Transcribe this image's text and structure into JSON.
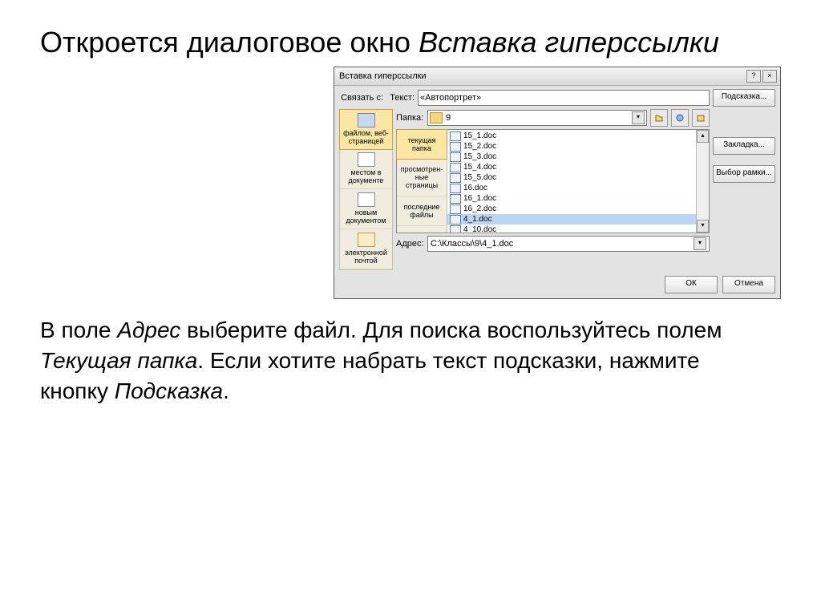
{
  "heading": {
    "prefix": "Откроется диалоговое окно ",
    "italic": "Вставка гиперссылки"
  },
  "dialog": {
    "title": "Вставка гиперссылки",
    "help_btn": "?",
    "close_btn": "×",
    "link_to_label": "Связать с:",
    "text_label": "Текст:",
    "text_value": "«Автопортрет»",
    "tooltip_btn": "Подсказка...",
    "link_to": [
      "файлом, веб-страницей",
      "местом в документе",
      "новым документом",
      "электронной почтой"
    ],
    "folder_label": "Папка:",
    "folder_value": "9",
    "tabs": [
      "текущая папка",
      "просмотрен-ные страницы",
      "последние файлы"
    ],
    "files": [
      "15_1.doc",
      "15_2.doc",
      "15_3.doc",
      "15_4.doc",
      "15_5.doc",
      "16.doc",
      "16_1.doc",
      "16_2.doc",
      "4_1.doc",
      "4_10.doc"
    ],
    "selected_file_index": 8,
    "address_label": "Адрес:",
    "address_value": "C:\\Классы\\9\\4_1.doc",
    "bookmark_btn": "Закладка...",
    "frame_btn": "Выбор рамки...",
    "ok_btn": "ОК",
    "cancel_btn": "Отмена"
  },
  "paragraph": {
    "p1a": "В поле ",
    "p1b": "Адрес",
    "p1c": " выберите файл. Для поиска воспользуйтесь полем ",
    "p1d": "Текущая папка",
    "p1e": ". Если хотите набрать текст подсказки, нажмите кнопку ",
    "p1f": "Подсказка",
    "p1g": "."
  }
}
